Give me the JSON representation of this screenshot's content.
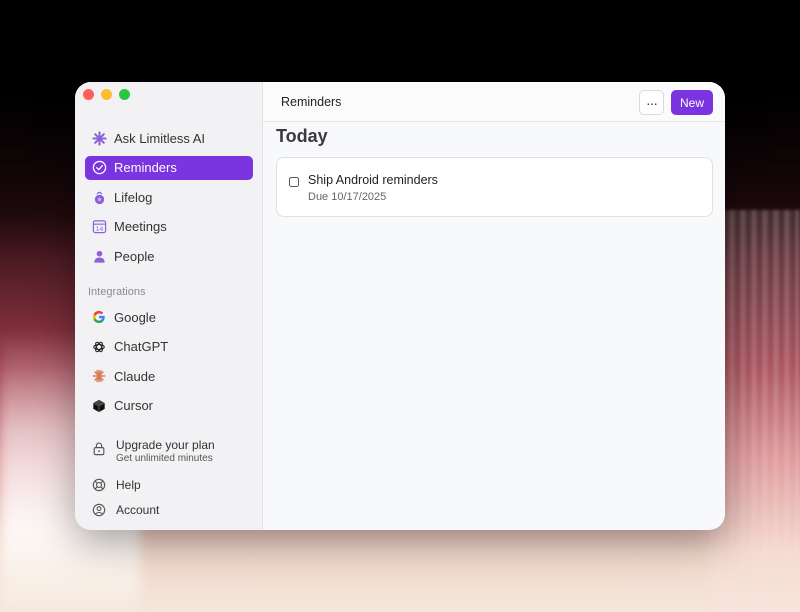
{
  "sidebar": {
    "nav": [
      {
        "label": "Ask Limitless AI",
        "icon": "sparkle-icon"
      },
      {
        "label": "Reminders",
        "icon": "check-circle-icon",
        "active": true
      },
      {
        "label": "Lifelog",
        "icon": "pendant-icon"
      },
      {
        "label": "Meetings",
        "icon": "calendar-icon"
      },
      {
        "label": "People",
        "icon": "person-icon"
      }
    ],
    "integrations_label": "Integrations",
    "integrations": [
      {
        "label": "Google",
        "icon": "google-icon"
      },
      {
        "label": "ChatGPT",
        "icon": "chatgpt-icon"
      },
      {
        "label": "Claude",
        "icon": "claude-icon"
      },
      {
        "label": "Cursor",
        "icon": "cursor-icon"
      }
    ],
    "upgrade": {
      "title": "Upgrade your plan",
      "subtitle": "Get unlimited minutes"
    },
    "help_label": "Help",
    "account_label": "Account"
  },
  "header": {
    "title": "Reminders",
    "more_label": "···",
    "new_label": "New"
  },
  "main": {
    "section_title": "Today",
    "reminders": [
      {
        "title": "Ship Android reminders",
        "due": "Due 10/17/2025"
      }
    ]
  },
  "colors": {
    "accent": "#7a34e0",
    "sidebar_bg": "#f2f2f4",
    "content_bg": "#f8f9fb"
  }
}
